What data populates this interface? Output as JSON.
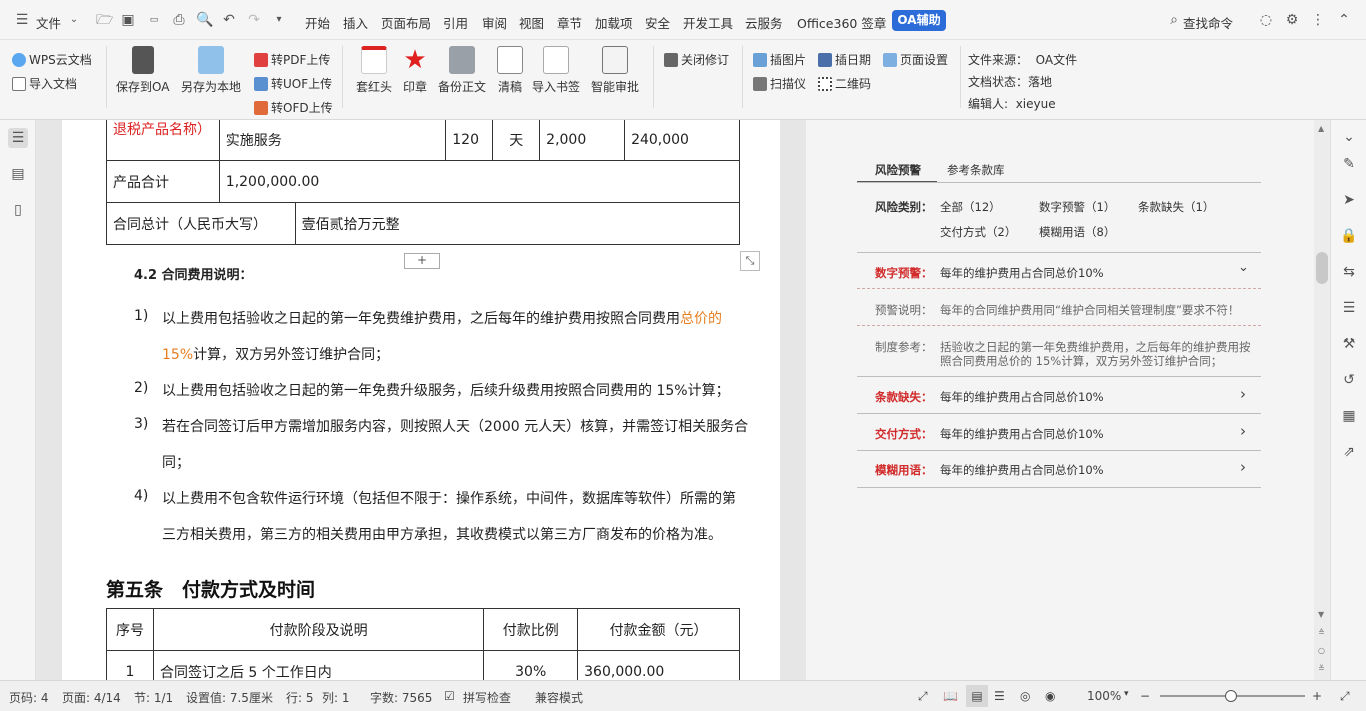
{
  "titlebar": {
    "file_menu": "文件",
    "menus": [
      "开始",
      "插入",
      "页面布局",
      "引用",
      "审阅",
      "视图",
      "章节",
      "加载项",
      "安全",
      "开发工具",
      "云服务",
      "Office360 签章"
    ],
    "oa_tab": "OA辅助",
    "search": "查找命令"
  },
  "ribbon": {
    "wps_cloud": "WPS云文档",
    "import_doc": "导入文档",
    "save_oa": "保存到OA",
    "save_local": "另存为本地",
    "to_pdf": "转PDF上传",
    "to_uof": "转UOF上传",
    "to_ofd": "转OFD上传",
    "red_head": "套红头",
    "seal": "印章",
    "backup": "备份正文",
    "clean": "清稿",
    "import_bookmark": "导入书签",
    "smart_approve": "智能审批",
    "close_revision": "关闭修订",
    "insert_image": "插图片",
    "insert_date": "插日期",
    "page_setup": "页面设置",
    "scanner": "扫描仪",
    "qrcode": "二维码",
    "file_source_label": "文件来源：",
    "file_source_value": "OA文件",
    "file_status_label": "文档状态：",
    "file_status_value": "落地",
    "editor_label": "编辑人:",
    "editor_value": "xieyue"
  },
  "document": {
    "table1": {
      "cut_label": "退税产品名称）",
      "service_name": "实施服务",
      "qty": "120",
      "unit": "天",
      "price": "2,000",
      "amount": "240,000",
      "subtotal_label": "产品合计",
      "subtotal_value": "1,200,000.00",
      "total_label": "合同总计（人民币大写）",
      "total_value": "壹佰贰拾万元整"
    },
    "section_42": "4.2 合同费用说明：",
    "items": [
      {
        "num": "1)",
        "line1_a": "以上费用包括验收之日起的第一年免费维护费用，之后每年的维护费用按照合同费用",
        "line1_b": "总价的",
        "line2_a": "15%",
        "line2_b": "计算，双方另外签订维护合同；"
      },
      {
        "num": "2)",
        "line1": "以上费用包括验收之日起的第一年免费升级服务，后续升级费用按照合同费用的 15%计算；"
      },
      {
        "num": "3)",
        "line1": "若在合同签订后甲方需增加服务内容，则按照人天（2000 元人天）核算，并需签订相关服务合",
        "line2": "同；"
      },
      {
        "num": "4)",
        "line1": "以上费用不包含软件运行环境（包括但不限于：操作系统，中间件，数据库等软件）所需的第",
        "line2": "三方相关费用，第三方的相关费用由甲方承担，其收费模式以第三方厂商发布的价格为准。"
      }
    ],
    "article5_title": "第五条　付款方式及时间",
    "table2": {
      "headers": [
        "序号",
        "付款阶段及说明",
        "付款比例",
        "付款金额（元）"
      ],
      "row1": [
        "1",
        "合同签订之后 5 个工作日内",
        "30%",
        "360,000.00"
      ]
    }
  },
  "panel": {
    "tab_risk": "风险预警",
    "tab_clause": "参考条款库",
    "category_label": "风险类别：",
    "cat_all": "全部（12）",
    "cat_digit": "数字预警（1）",
    "cat_missing": "条款缺失（1）",
    "cat_delivery": "交付方式（2）",
    "cat_vague": "模糊用语（8）",
    "digit_label": "数字预警：",
    "digit_text": "每年的维护费用占合同总价10%",
    "warn_label": "预警说明：",
    "warn_text": "每年的合同维护费用同“维护合同相关管理制度”要求不符！",
    "ref_label": "制度参考：",
    "ref_text1": "括验收之日起的第一年免费维护费用，之后每年的维护费用按",
    "ref_text2": "照合同费用总价的 15%计算，双方另外签订维护合同；",
    "missing_label": "条款缺失：",
    "missing_text": "每年的维护费用占合同总价10%",
    "delivery_label": "交付方式：",
    "delivery_text": "每年的维护费用占合同总价10%",
    "vague_label": "模糊用语：",
    "vague_text": "每年的维护费用占合同总价10%"
  },
  "statusbar": {
    "page_no": "页码: 4",
    "page": "页面: 4/14",
    "section": "节: 1/1",
    "setting": "设置值: 7.5厘米",
    "row": "行: 5",
    "col": "列: 1",
    "words": "字数: 7565",
    "spell": "拼写检查",
    "compat": "兼容模式",
    "zoom": "100%"
  }
}
